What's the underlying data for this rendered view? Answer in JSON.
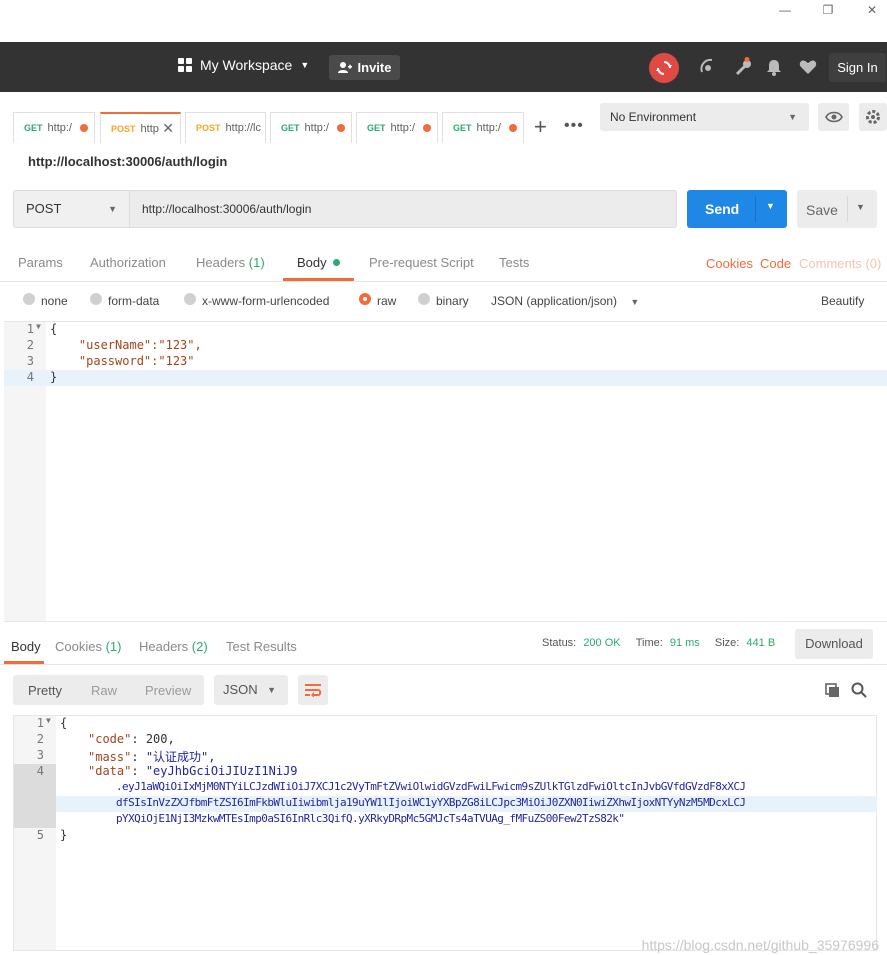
{
  "header": {
    "workspace_label": "My Workspace",
    "invite_label": "Invite",
    "signin_label": "Sign In"
  },
  "tabs": [
    {
      "method": "GET",
      "url": "http:/",
      "active": false
    },
    {
      "method": "POST",
      "url": "http",
      "active": true
    },
    {
      "method": "POST",
      "url": "http://lc",
      "active": false
    },
    {
      "method": "GET",
      "url": "http:/",
      "active": false
    },
    {
      "method": "GET",
      "url": "http:/",
      "active": false
    },
    {
      "method": "GET",
      "url": "http:/",
      "active": false
    }
  ],
  "environment": {
    "selected": "No Environment"
  },
  "request": {
    "title": "http://localhost:30006/auth/login",
    "method": "POST",
    "url": "http://localhost:30006/auth/login",
    "send_label": "Send",
    "save_label": "Save"
  },
  "request_tabs": {
    "params": "Params",
    "authorization": "Authorization",
    "headers": "Headers",
    "headers_count": "(1)",
    "body": "Body",
    "prerequest": "Pre-request Script",
    "tests": "Tests",
    "cookies": "Cookies",
    "code": "Code",
    "comments": "Comments (0)"
  },
  "body_types": {
    "none": "none",
    "form_data": "form-data",
    "urlencoded": "x-www-form-urlencoded",
    "raw": "raw",
    "binary": "binary",
    "content_type": "JSON (application/json)",
    "beautify": "Beautify"
  },
  "request_body": {
    "line_numbers": [
      "1",
      "2",
      "3",
      "4"
    ],
    "lines": [
      "{",
      "    \"userName\":\"123\",",
      "    \"password\":\"123\"",
      "}"
    ]
  },
  "response_tabs": {
    "body": "Body",
    "cookies": "Cookies",
    "cookies_count": "(1)",
    "headers": "Headers",
    "headers_count": "(2)",
    "test_results": "Test Results",
    "status_label": "Status:",
    "status_value": "200 OK",
    "time_label": "Time:",
    "time_value": "91 ms",
    "size_label": "Size:",
    "size_value": "441 B",
    "download_label": "Download"
  },
  "response_view": {
    "pretty": "Pretty",
    "raw": "Raw",
    "preview": "Preview",
    "format": "JSON"
  },
  "response_body": {
    "line_numbers": [
      "1",
      "2",
      "3",
      "4",
      "5"
    ],
    "open_brace": "{",
    "code_key": "\"code\"",
    "code_value": "200,",
    "mass_key": "\"mass\"",
    "mass_value": "\"认证成功\",",
    "data_key": "\"data\"",
    "data_line1": "\"eyJhbGciOiJIUzI1NiJ9",
    "data_line2": ".eyJ1aWQiOiIxMjM0NTYiLCJzdWIiOiJ7XCJ1c2VyTmFtZVwiOlwidGVzdFwiLFwicm9sZUlkTGlzdFwiOltcInJvbGVfdGVzdF8xXCJ",
    "data_line3": "dfSIsInVzZXJfbmFtZSI6ImFkbWluIiwibmlja19uYW1lIjoiWC1yYXBpZG8iLCJpc3MiOiJ0ZXN0IiwiZXhwIjoxNTYyNzM5MDcxLCJ",
    "data_line4": "pYXQiOjE1NjI3MzkwMTEsImp0aSI6InRlc3QifQ.yXRkyDRpMc5GMJcTs4aTVUAg_fMFuZS00Few2TzS82k\"",
    "close_brace": "}"
  },
  "watermark": "https://blog.csdn.net/github_35976996",
  "colors": {
    "accent_orange": "#f26b3a",
    "send_blue": "#1f87e5",
    "header_dark": "#333333",
    "get_green": "#2aaa6f"
  }
}
